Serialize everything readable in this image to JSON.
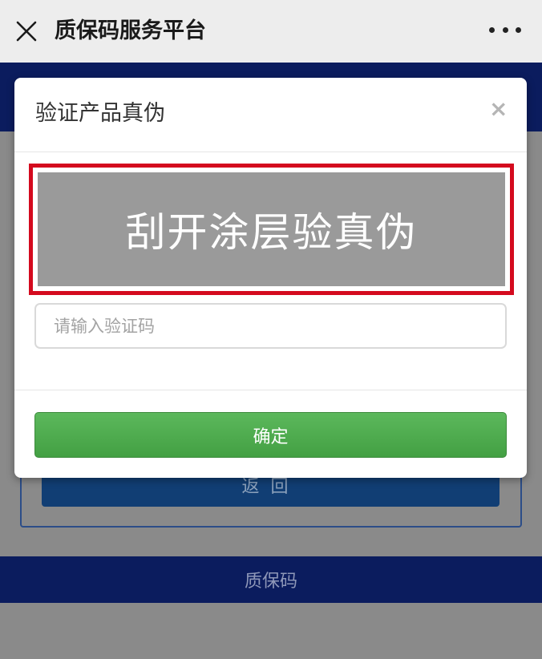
{
  "titlebar": {
    "title": "质保码服务平台",
    "close_icon": "close-icon",
    "more_icon": "more-dots-icon"
  },
  "background_page": {
    "return_label": "返回",
    "footer_text": "质保码"
  },
  "modal": {
    "title": "验证产品真伪",
    "close_symbol": "×",
    "scratch_label": "刮开涂层验真伪",
    "code_placeholder": "请输入验证码",
    "confirm_label": "确定"
  },
  "colors": {
    "navy_band": "#0b1c5e",
    "return_button": "#113e74",
    "scratch_border": "#d40a1e",
    "confirm_green": "#5cb85c"
  }
}
